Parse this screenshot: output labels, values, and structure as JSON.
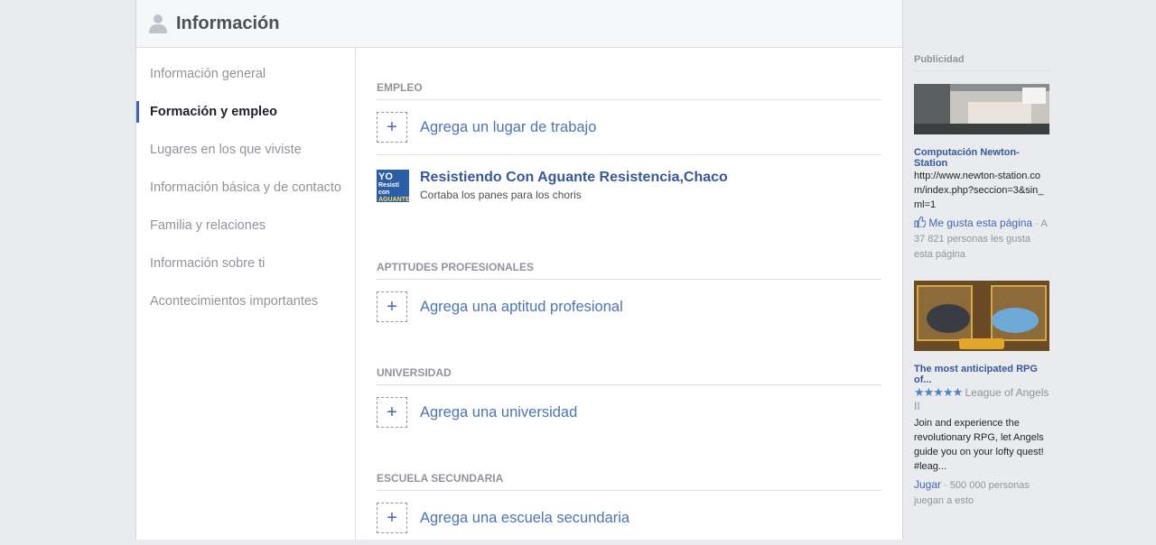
{
  "header": {
    "title": "Información"
  },
  "sidebar": {
    "items": [
      {
        "label": "Información general"
      },
      {
        "label": "Formación y empleo",
        "active": true
      },
      {
        "label": "Lugares en los que viviste"
      },
      {
        "label": "Información básica y de contacto"
      },
      {
        "label": "Familia y relaciones"
      },
      {
        "label": "Información sobre ti"
      },
      {
        "label": "Acontecimientos importantes"
      }
    ]
  },
  "sections": {
    "empleo": {
      "title": "EMPLEO",
      "add_label": "Agrega un lugar de trabajo",
      "job": {
        "title": "Resistiendo Con Aguante Resistencia,Chaco",
        "subtitle": "Cortaba los panes para los choris",
        "logo_text_1": "YO",
        "logo_text_2": "Resistí con",
        "logo_text_3": "AGUANTE"
      }
    },
    "aptitudes": {
      "title": "APTITUDES PROFESIONALES",
      "add_label": "Agrega una aptitud profesional"
    },
    "universidad": {
      "title": "UNIVERSIDAD",
      "add_label": "Agrega una universidad"
    },
    "secundaria": {
      "title": "ESCUELA SECUNDARIA",
      "add_label": "Agrega una escuela secundaria"
    }
  },
  "ads": {
    "title": "Publicidad",
    "ad1": {
      "name": "Computación Newton-Station",
      "url": "http://www.newton-station.com/index.php?seccion=3&sin_ml=1",
      "like_label": "Me gusta esta página",
      "meta": "· A 37 821 personas les gusta esta página"
    },
    "ad2": {
      "name": "The most anticipated RPG of...",
      "stars": "★★★★★",
      "app": "League of Angels II",
      "text": "Join and experience the revolutionary RPG, let Angels guide you on your lofty quest! #leag...",
      "cta": "Jugar",
      "meta": "· 500 000 personas juegan a esto"
    }
  },
  "colors": {
    "accent": "#4267b2",
    "link": "#4b75b3"
  }
}
